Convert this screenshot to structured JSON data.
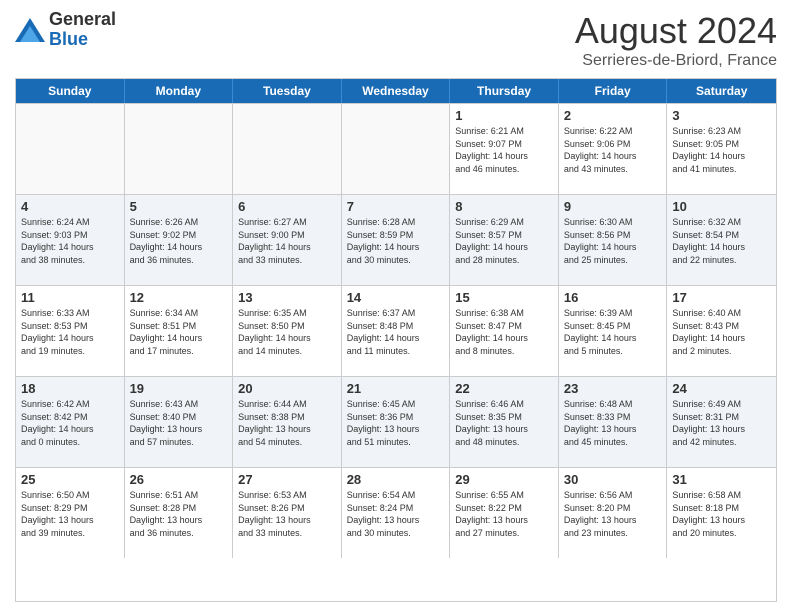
{
  "header": {
    "logo_line1": "General",
    "logo_line2": "Blue",
    "title": "August 2024",
    "subtitle": "Serrieres-de-Briord, France"
  },
  "calendar": {
    "days_of_week": [
      "Sunday",
      "Monday",
      "Tuesday",
      "Wednesday",
      "Thursday",
      "Friday",
      "Saturday"
    ],
    "weeks": [
      [
        {
          "day": "",
          "info": ""
        },
        {
          "day": "",
          "info": ""
        },
        {
          "day": "",
          "info": ""
        },
        {
          "day": "",
          "info": ""
        },
        {
          "day": "1",
          "info": "Sunrise: 6:21 AM\nSunset: 9:07 PM\nDaylight: 14 hours\nand 46 minutes."
        },
        {
          "day": "2",
          "info": "Sunrise: 6:22 AM\nSunset: 9:06 PM\nDaylight: 14 hours\nand 43 minutes."
        },
        {
          "day": "3",
          "info": "Sunrise: 6:23 AM\nSunset: 9:05 PM\nDaylight: 14 hours\nand 41 minutes."
        }
      ],
      [
        {
          "day": "4",
          "info": "Sunrise: 6:24 AM\nSunset: 9:03 PM\nDaylight: 14 hours\nand 38 minutes."
        },
        {
          "day": "5",
          "info": "Sunrise: 6:26 AM\nSunset: 9:02 PM\nDaylight: 14 hours\nand 36 minutes."
        },
        {
          "day": "6",
          "info": "Sunrise: 6:27 AM\nSunset: 9:00 PM\nDaylight: 14 hours\nand 33 minutes."
        },
        {
          "day": "7",
          "info": "Sunrise: 6:28 AM\nSunset: 8:59 PM\nDaylight: 14 hours\nand 30 minutes."
        },
        {
          "day": "8",
          "info": "Sunrise: 6:29 AM\nSunset: 8:57 PM\nDaylight: 14 hours\nand 28 minutes."
        },
        {
          "day": "9",
          "info": "Sunrise: 6:30 AM\nSunset: 8:56 PM\nDaylight: 14 hours\nand 25 minutes."
        },
        {
          "day": "10",
          "info": "Sunrise: 6:32 AM\nSunset: 8:54 PM\nDaylight: 14 hours\nand 22 minutes."
        }
      ],
      [
        {
          "day": "11",
          "info": "Sunrise: 6:33 AM\nSunset: 8:53 PM\nDaylight: 14 hours\nand 19 minutes."
        },
        {
          "day": "12",
          "info": "Sunrise: 6:34 AM\nSunset: 8:51 PM\nDaylight: 14 hours\nand 17 minutes."
        },
        {
          "day": "13",
          "info": "Sunrise: 6:35 AM\nSunset: 8:50 PM\nDaylight: 14 hours\nand 14 minutes."
        },
        {
          "day": "14",
          "info": "Sunrise: 6:37 AM\nSunset: 8:48 PM\nDaylight: 14 hours\nand 11 minutes."
        },
        {
          "day": "15",
          "info": "Sunrise: 6:38 AM\nSunset: 8:47 PM\nDaylight: 14 hours\nand 8 minutes."
        },
        {
          "day": "16",
          "info": "Sunrise: 6:39 AM\nSunset: 8:45 PM\nDaylight: 14 hours\nand 5 minutes."
        },
        {
          "day": "17",
          "info": "Sunrise: 6:40 AM\nSunset: 8:43 PM\nDaylight: 14 hours\nand 2 minutes."
        }
      ],
      [
        {
          "day": "18",
          "info": "Sunrise: 6:42 AM\nSunset: 8:42 PM\nDaylight: 14 hours\nand 0 minutes."
        },
        {
          "day": "19",
          "info": "Sunrise: 6:43 AM\nSunset: 8:40 PM\nDaylight: 13 hours\nand 57 minutes."
        },
        {
          "day": "20",
          "info": "Sunrise: 6:44 AM\nSunset: 8:38 PM\nDaylight: 13 hours\nand 54 minutes."
        },
        {
          "day": "21",
          "info": "Sunrise: 6:45 AM\nSunset: 8:36 PM\nDaylight: 13 hours\nand 51 minutes."
        },
        {
          "day": "22",
          "info": "Sunrise: 6:46 AM\nSunset: 8:35 PM\nDaylight: 13 hours\nand 48 minutes."
        },
        {
          "day": "23",
          "info": "Sunrise: 6:48 AM\nSunset: 8:33 PM\nDaylight: 13 hours\nand 45 minutes."
        },
        {
          "day": "24",
          "info": "Sunrise: 6:49 AM\nSunset: 8:31 PM\nDaylight: 13 hours\nand 42 minutes."
        }
      ],
      [
        {
          "day": "25",
          "info": "Sunrise: 6:50 AM\nSunset: 8:29 PM\nDaylight: 13 hours\nand 39 minutes."
        },
        {
          "day": "26",
          "info": "Sunrise: 6:51 AM\nSunset: 8:28 PM\nDaylight: 13 hours\nand 36 minutes."
        },
        {
          "day": "27",
          "info": "Sunrise: 6:53 AM\nSunset: 8:26 PM\nDaylight: 13 hours\nand 33 minutes."
        },
        {
          "day": "28",
          "info": "Sunrise: 6:54 AM\nSunset: 8:24 PM\nDaylight: 13 hours\nand 30 minutes."
        },
        {
          "day": "29",
          "info": "Sunrise: 6:55 AM\nSunset: 8:22 PM\nDaylight: 13 hours\nand 27 minutes."
        },
        {
          "day": "30",
          "info": "Sunrise: 6:56 AM\nSunset: 8:20 PM\nDaylight: 13 hours\nand 23 minutes."
        },
        {
          "day": "31",
          "info": "Sunrise: 6:58 AM\nSunset: 8:18 PM\nDaylight: 13 hours\nand 20 minutes."
        }
      ]
    ]
  }
}
